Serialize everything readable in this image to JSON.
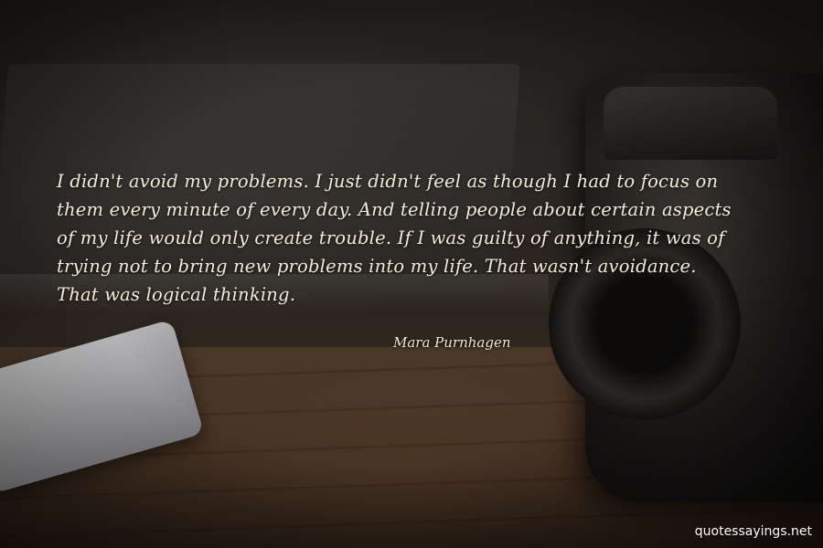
{
  "quote": {
    "lines": [
      "I didn't avoid my problems. I just didn't feel as though I had to focus on",
      "them every minute of every day. And telling people about certain aspects",
      "of my life would only create trouble. If I was guilty of anything, it was of",
      "trying not to bring new problems into my life. That wasn't avoidance.",
      "That was logical thinking."
    ],
    "author": "Mara Purnhagen"
  },
  "watermark": "quotessayings.net"
}
